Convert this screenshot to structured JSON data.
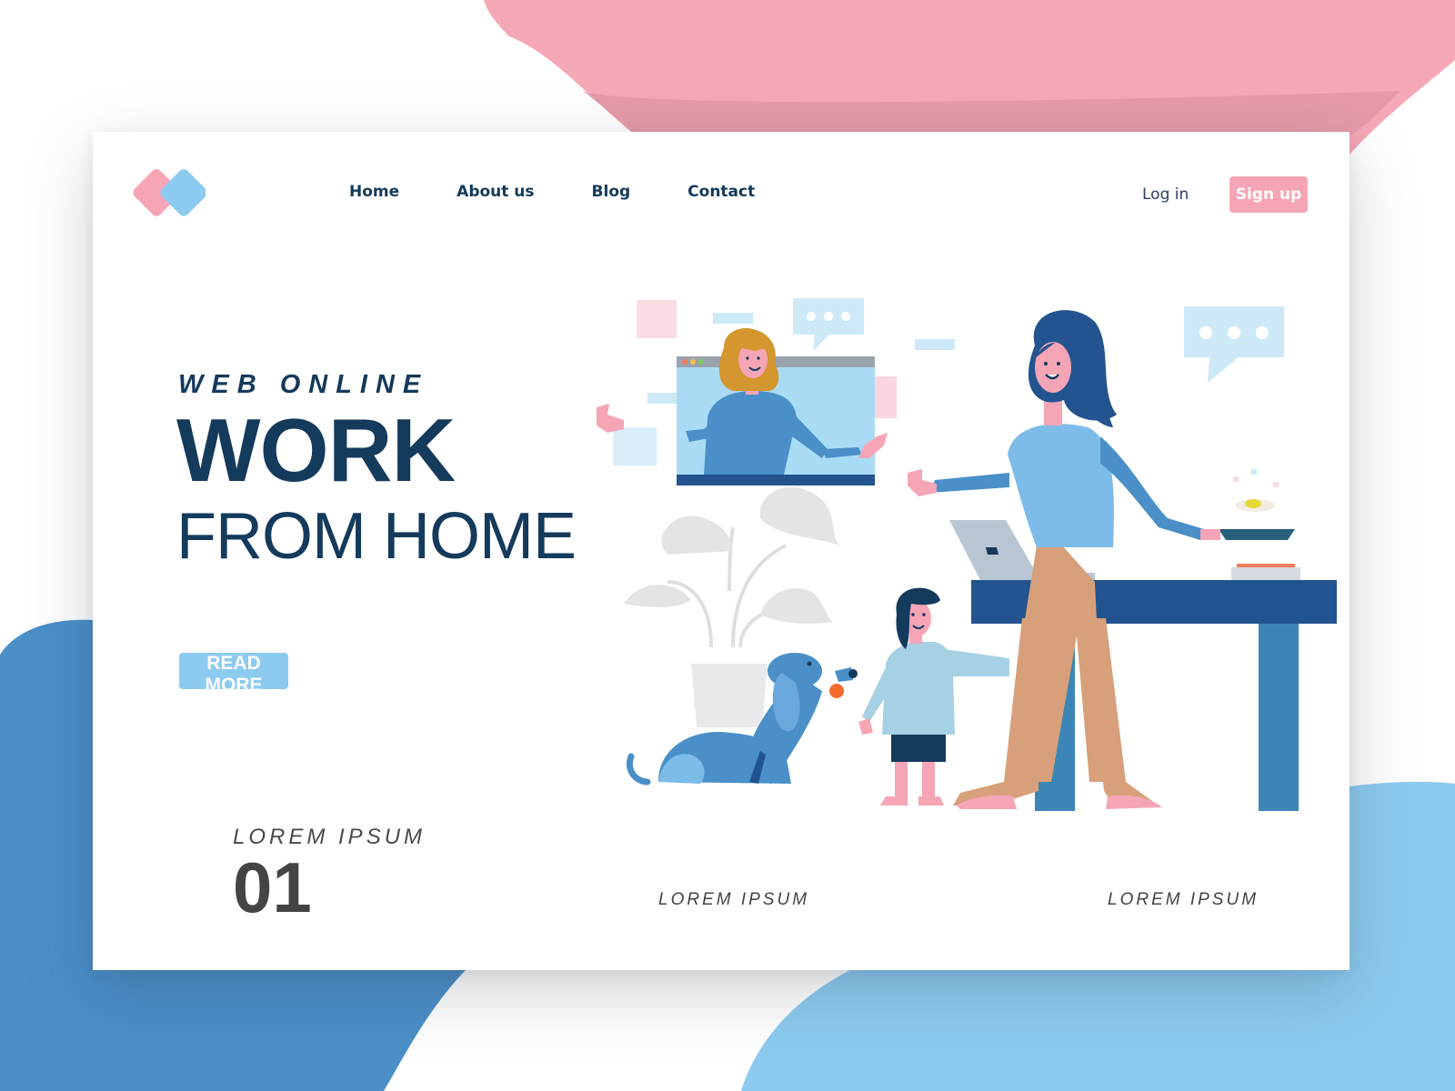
{
  "colors": {
    "navy": "#143a5c",
    "pink": "#f5a5b5",
    "light_blue": "#8ccbef",
    "mid_blue": "#4a8fc8",
    "text_gray": "#444444"
  },
  "logo": {
    "icon": "two-diamond-logo-icon"
  },
  "nav": {
    "items": [
      {
        "label": "Home"
      },
      {
        "label": "About us"
      },
      {
        "label": "Blog"
      },
      {
        "label": "Contact"
      }
    ]
  },
  "auth": {
    "login_label": "Log in",
    "signup_label": "Sign up"
  },
  "hero": {
    "kicker": "WEB ONLINE",
    "title": "WORK",
    "subtitle": "FROM HOME",
    "cta_label": "READ MORE"
  },
  "slide": {
    "label": "LOREM IPSUM",
    "number": "01"
  },
  "footer": {
    "items": [
      "LOREM IPSUM",
      "LOREM IPSUM"
    ]
  },
  "illustration": {
    "icons": [
      "video-call-window-icon",
      "chat-bubble-icon",
      "laptop-icon",
      "frying-pan-icon",
      "potted-plant-icon",
      "dog-icon"
    ]
  }
}
